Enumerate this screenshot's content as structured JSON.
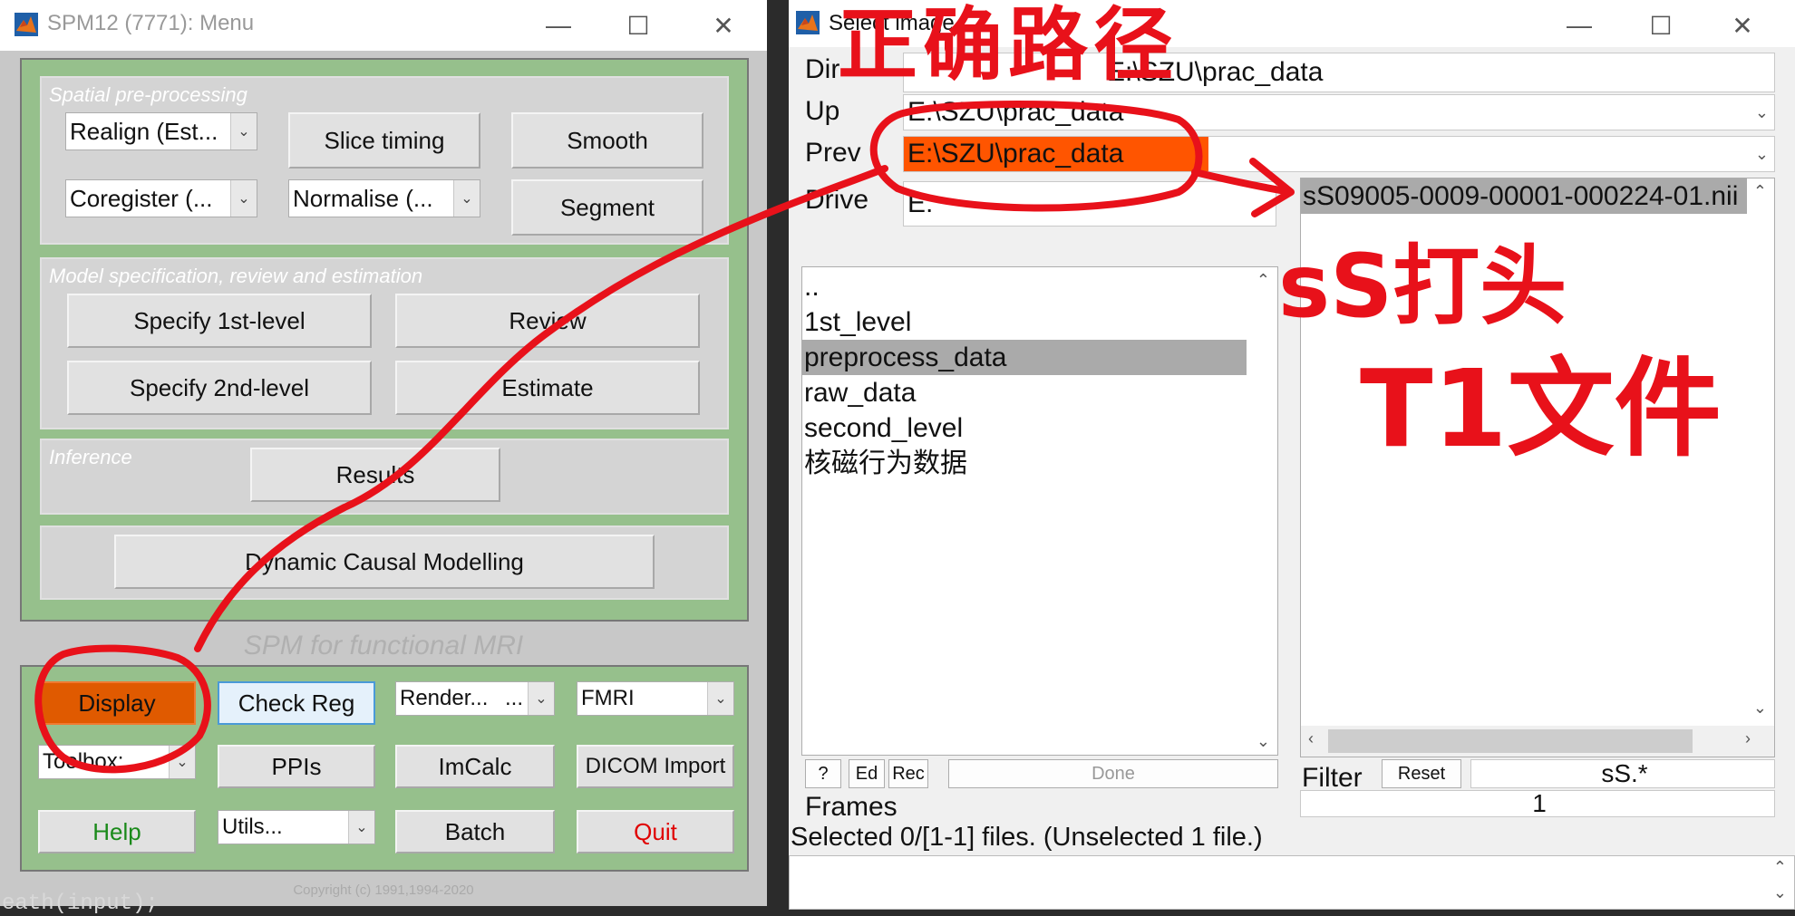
{
  "spm_window": {
    "title": "SPM12 (7771): Menu",
    "panels": {
      "spatial": {
        "label": "Spatial pre-processing",
        "realign": "Realign (Est...",
        "slice_timing": "Slice timing",
        "smooth": "Smooth",
        "coregister": "Coregister (...",
        "normalise": "Normalise (...",
        "segment": "Segment"
      },
      "model": {
        "label": "Model specification, review and estimation",
        "specify1": "Specify 1st-level",
        "review": "Review",
        "specify2": "Specify 2nd-level",
        "estimate": "Estimate"
      },
      "inference": {
        "label": "Inference",
        "results": "Results"
      },
      "dcm": "Dynamic Causal Modelling"
    },
    "subtitle": "SPM for functional MRI",
    "bottom": {
      "display": "Display",
      "check_reg": "Check Reg",
      "render": "Render...",
      "render_dots": "...",
      "fmri": "FMRI",
      "toolbox": "Toolbox:",
      "ppis": "PPIs",
      "imcalc": "ImCalc",
      "dicom": "DICOM Import",
      "help": "Help",
      "utils": "Utils...",
      "batch": "Batch",
      "quit": "Quit"
    },
    "copyright": "Copyright (c) 1991,1994-2020"
  },
  "select_window": {
    "title": "Select image",
    "dir_label": "Dir",
    "dir_value": "E:\\SZU\\prac_data",
    "up_label": "Up",
    "up_value": "E:\\SZU\\prac_data",
    "prev_label": "Prev",
    "prev_value": "E:\\SZU\\prac_data",
    "drive_label": "Drive",
    "drive_value": "E:",
    "folders": [
      "..",
      "1st_level",
      "preprocess_data",
      "raw_data",
      "second_level",
      "核磁行为数据"
    ],
    "selected_folder_index": 2,
    "files": [
      "sS09005-0009-00001-000224-01.nii"
    ],
    "buttons": {
      "help": "?",
      "ed": "Ed",
      "rec": "Rec",
      "done": "Done",
      "reset": "Reset"
    },
    "filter_label": "Filter",
    "filter_value": "sS.*",
    "frames_label": "Frames",
    "frames_value": "1",
    "status": "Selected 0/[1-1] files. (Unselected 1 file.)"
  },
  "annotations": {
    "correct_path": "正确路径",
    "ss_prefix": "sS打头",
    "t1_file": "T1文件"
  },
  "background_code": "eath(input);",
  "colors": {
    "spm_green": "#96c08c",
    "display_orange": "#e05a00",
    "annotation_red": "#e8111a",
    "help_green": "#1a8a1a",
    "quit_red": "#e00000"
  }
}
